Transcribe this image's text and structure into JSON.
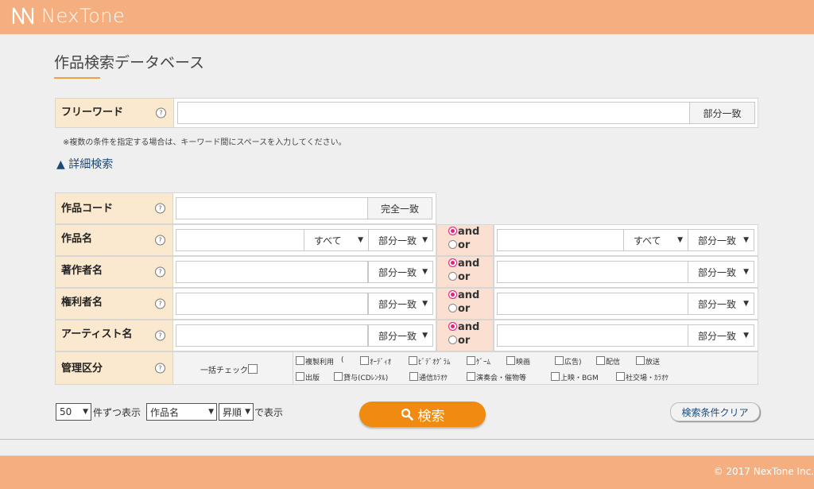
{
  "header": {
    "logo_text": "NexTone"
  },
  "page_title": "作品検索データベース",
  "freeword": {
    "label": "フリーワード",
    "help": "?",
    "match_label": "部分一致",
    "note": "※複数の条件を指定する場合は、キーワード間にスペースを入力してください。"
  },
  "advanced_toggle": "▲ 詳細検索",
  "rows": {
    "code": {
      "label": "作品コード",
      "match": "完全一致"
    },
    "title": {
      "label": "作品名",
      "scope": "すべて",
      "match": "部分一致",
      "scope2": "すべて",
      "match2": "部分一致"
    },
    "author": {
      "label": "著作者名",
      "match": "部分一致",
      "match2": "部分一致"
    },
    "rights": {
      "label": "権利者名",
      "match": "部分一致",
      "match2": "部分一致"
    },
    "artist": {
      "label": "アーティスト名",
      "match": "部分一致",
      "match2": "部分一致"
    }
  },
  "andor": {
    "and": "and",
    "or": "or"
  },
  "management": {
    "label": "管理区分",
    "bulk_check": "一括チェック",
    "row1": [
      "複製利用",
      "(",
      "ｵｰﾃﾞｨｵ",
      "ﾋﾞﾃﾞｵｸﾞﾗﾑ",
      "ｹﾞｰﾑ",
      "映画",
      "広告)",
      "配信",
      "放送"
    ],
    "row2": [
      "出版",
      "貸与(CDﾚﾝﾀﾙ)",
      "通信ｶﾗｵｹ",
      "演奏会・催物等",
      "上映・BGM",
      "社交場・ｶﾗｵｹ"
    ]
  },
  "results": {
    "per_page": "50",
    "per_page_suffix": "件ずつ表示",
    "sort_field": "作品名",
    "sort_order": "昇順",
    "sort_suffix": "で表示"
  },
  "search_button": "検索",
  "clear_button": "検索条件クリア",
  "footer": {
    "copyright": "© 2017 NexTone Inc."
  }
}
